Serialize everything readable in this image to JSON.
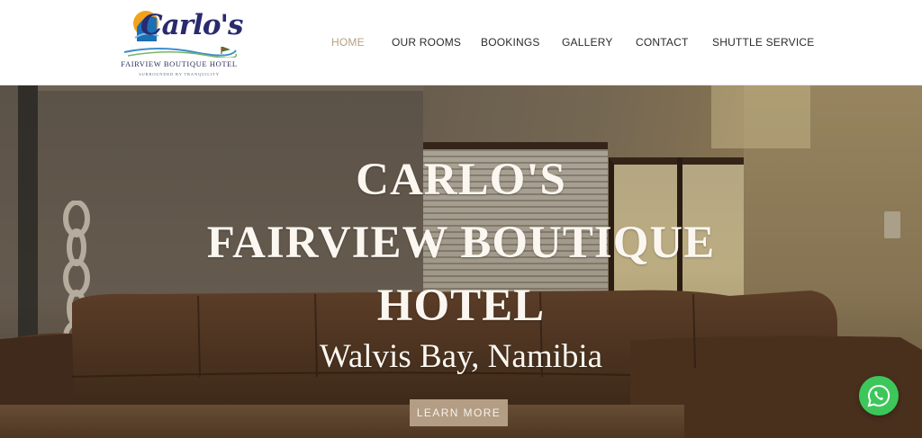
{
  "brand": {
    "logo_word": "Carlo's",
    "logo_name": "FAIRVIEW BOUTIQUE HOTEL",
    "logo_tagline": "SURROUNDED BY TRANQUILITY"
  },
  "nav": {
    "items": [
      {
        "label": "HOME",
        "active": true
      },
      {
        "label": "OUR ROOMS",
        "active": false
      },
      {
        "label": "BOOKINGS",
        "active": false
      },
      {
        "label": "GALLERY",
        "active": false
      },
      {
        "label": "CONTACT",
        "active": false
      },
      {
        "label": "SHUTTLE SERVICE",
        "active": false
      }
    ],
    "active_color": "#b79f82",
    "text_color": "#2b2b2b"
  },
  "hero": {
    "title_lines": [
      "CARLO'S",
      "FAIRVIEW BOUTIQUE",
      "HOTEL"
    ],
    "subtitle": "Walvis Bay, Namibia",
    "button_label": "LEARN MORE",
    "button_color": "#b39d84",
    "background_image": "lounge with brown leather sofa"
  },
  "floating": {
    "whatsapp_icon": "whatsapp-icon",
    "color": "#3dc75a"
  }
}
